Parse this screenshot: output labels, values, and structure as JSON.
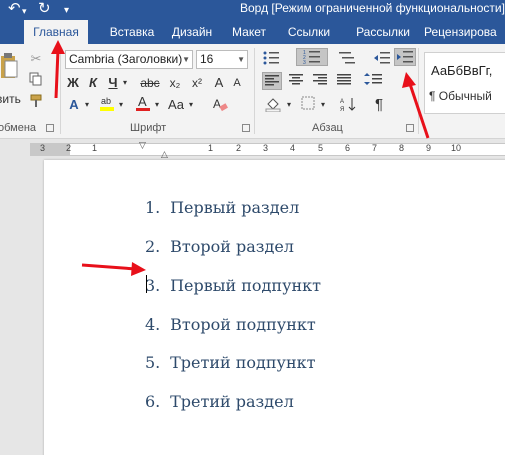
{
  "window": {
    "title": "Ворд [Режим ограниченной функциональности]"
  },
  "tabs": [
    {
      "label": "Главная",
      "active": true
    },
    {
      "label": "Вставка",
      "active": false
    },
    {
      "label": "Дизайн",
      "active": false
    },
    {
      "label": "Макет",
      "active": false
    },
    {
      "label": "Ссылки",
      "active": false
    },
    {
      "label": "Рассылки",
      "active": false
    },
    {
      "label": "Рецензирова",
      "active": false
    }
  ],
  "ribbon": {
    "paste_label": "вить",
    "clipboard_label": "обмена",
    "font_name": "Cambria (Заголовки)",
    "font_size": "16",
    "bold": "Ж",
    "italic": "К",
    "underline": "Ч",
    "strike": "abc",
    "subscript": "x₂",
    "superscript": "x²",
    "grow": "A",
    "shrink": "A",
    "case": "Aa",
    "font_group_label": "Шрифт",
    "paragraph_group_label": "Абзац",
    "pilcrow": "¶",
    "style_preview": "АаБбВвГг,",
    "style_name": "¶ Обычный"
  },
  "ruler": {
    "labels": [
      "3",
      "2",
      "1",
      "1",
      "2",
      "3",
      "4",
      "5",
      "6",
      "7",
      "8",
      "9",
      "10"
    ]
  },
  "document": {
    "items": [
      {
        "num": "1.",
        "text": "Первый раздел"
      },
      {
        "num": "2.",
        "text": "Второй раздел"
      },
      {
        "num": "3.",
        "text": "Первый подпункт"
      },
      {
        "num": "4.",
        "text": "Второй подпункт"
      },
      {
        "num": "5.",
        "text": "Третий подпункт"
      },
      {
        "num": "6.",
        "text": "Третий раздел"
      }
    ]
  },
  "colors": {
    "title_bar": "#2b579a",
    "ribbon_bg": "#f3f3f3",
    "list_text": "#2e4a6b",
    "annotation_arrow": "#e8101a",
    "highlight_yellow": "#ffff00",
    "font_color_red": "#e02020"
  }
}
